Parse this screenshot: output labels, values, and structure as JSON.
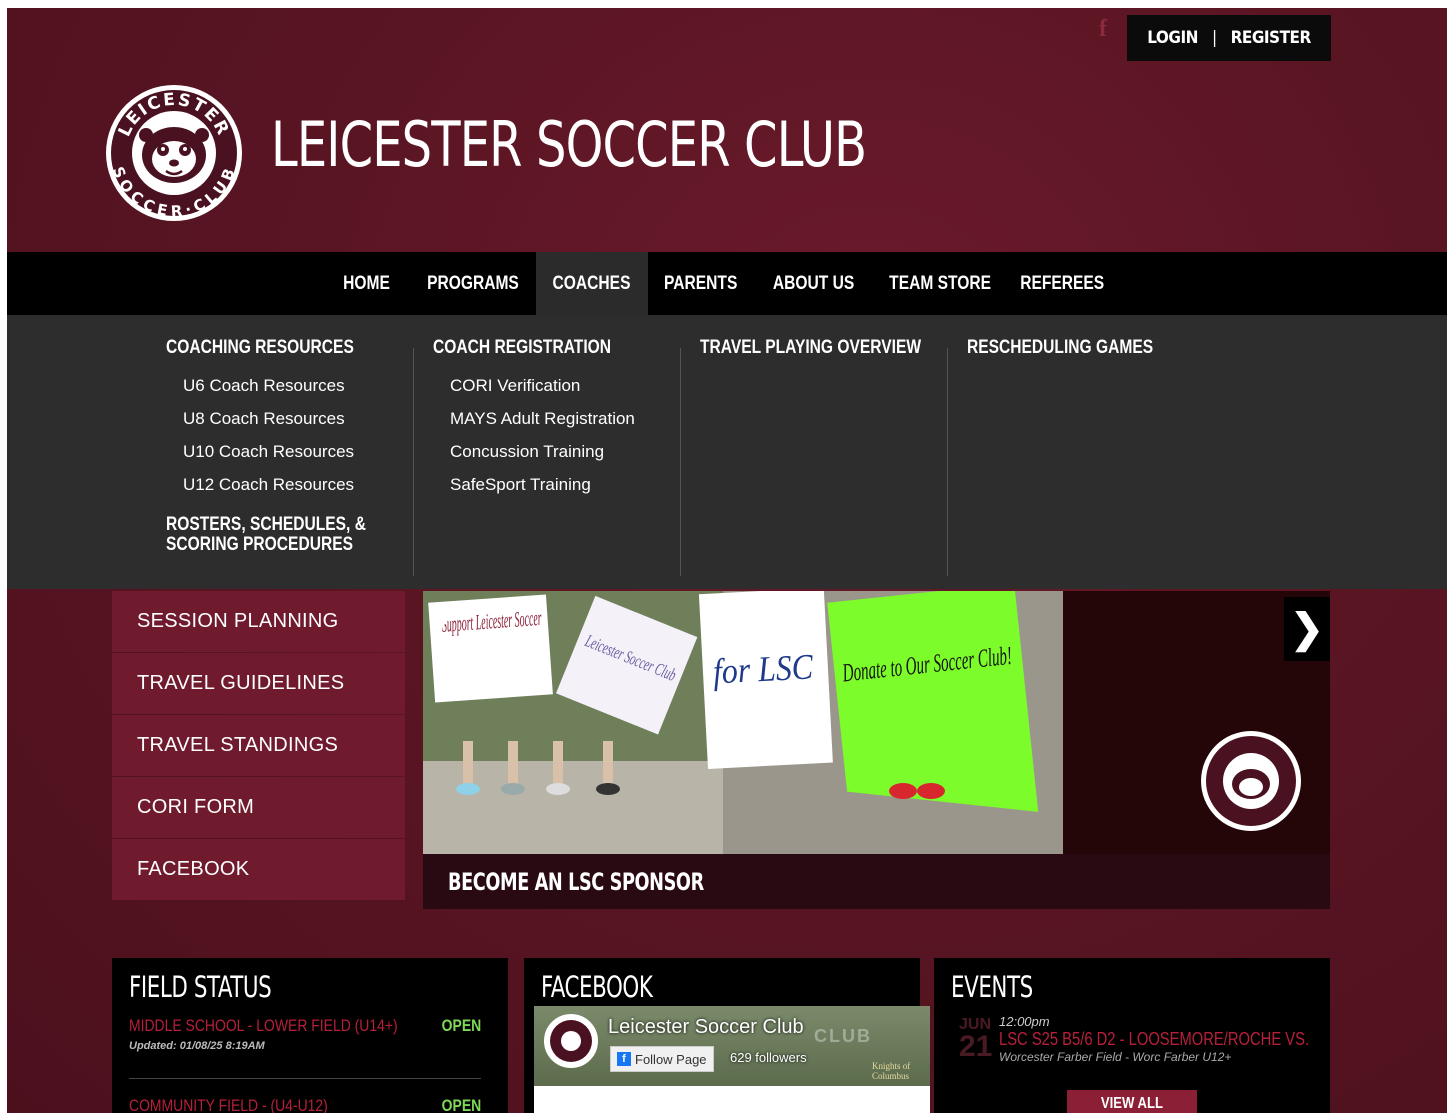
{
  "header": {
    "facebook_icon": "f",
    "login": "LOGIN",
    "separator": "|",
    "register": "REGISTER",
    "site_title": "LEICESTER SOCCER CLUB",
    "logo_text_top": "LEICESTER",
    "logo_text_bottom": "SOCCER·CLUB"
  },
  "nav": {
    "items": [
      {
        "label": "HOME"
      },
      {
        "label": "PROGRAMS"
      },
      {
        "label": "COACHES"
      },
      {
        "label": "PARENTS"
      },
      {
        "label": "ABOUT US"
      },
      {
        "label": "TEAM STORE"
      },
      {
        "label": "REFEREES"
      }
    ]
  },
  "dropdown": {
    "columns": [
      {
        "heading": "COACHING RESOURCES",
        "links": [
          "U6 Coach Resources",
          "U8 Coach Resources",
          "U10 Coach Resources",
          "U12 Coach Resources"
        ],
        "heading2_line1": "ROSTERS, SCHEDULES, &",
        "heading2_line2": "SCORING PROCEDURES"
      },
      {
        "heading": "COACH REGISTRATION",
        "links": [
          "CORI Verification",
          "MAYS Adult Registration",
          "Concussion Training",
          "SafeSport Training"
        ]
      },
      {
        "heading": "TRAVEL PLAYING OVERVIEW"
      },
      {
        "heading": "RESCHEDULING GAMES"
      }
    ]
  },
  "side_menu": {
    "items": [
      "SESSION PLANNING",
      "TRAVEL GUIDELINES",
      "TRAVEL STANDINGS",
      "CORI FORM",
      "FACEBOOK"
    ]
  },
  "slider": {
    "caption": "BECOME AN LSC SPONSOR",
    "prev_arrow": "❮",
    "next_arrow": "❯",
    "sign1": "Support Leicester Soccer",
    "sign2": "Leicester Soccer Club",
    "sign3": "for LSC",
    "sign4": "Donate to Our Soccer Club!"
  },
  "field_status": {
    "title": "FIELD STATUS",
    "rows": [
      {
        "name": "MIDDLE SCHOOL - LOWER FIELD (U14+)",
        "status": "OPEN",
        "updated": "Updated: 01/08/25 8:19AM"
      },
      {
        "name": "COMMUNITY FIELD - (U4-U12)",
        "status": "OPEN"
      }
    ]
  },
  "facebook": {
    "title": "FACEBOOK",
    "page_name": "Leicester Soccer Club",
    "follow_label": "Follow Page",
    "followers": "629 followers",
    "cover_text": "CLUB",
    "sponsor_text": "Knights of Columbus"
  },
  "events": {
    "title": "EVENTS",
    "month": "JUN",
    "day": "21",
    "time": "12:00pm",
    "event_title": "LSC S25 B5/6 D2 - LOOSEMORE/ROCHE VS.",
    "location": "Worcester Farber Field - Worc Farber U12+",
    "view_all": "VIEW ALL"
  },
  "colors": {
    "maroon_bg": "#5a1523",
    "side_item": "#6f1a2d",
    "accent_red": "#b81f3b",
    "open_green": "#7ed957",
    "nav_black": "#000000",
    "dropdown_gray": "#2d2d2d"
  }
}
